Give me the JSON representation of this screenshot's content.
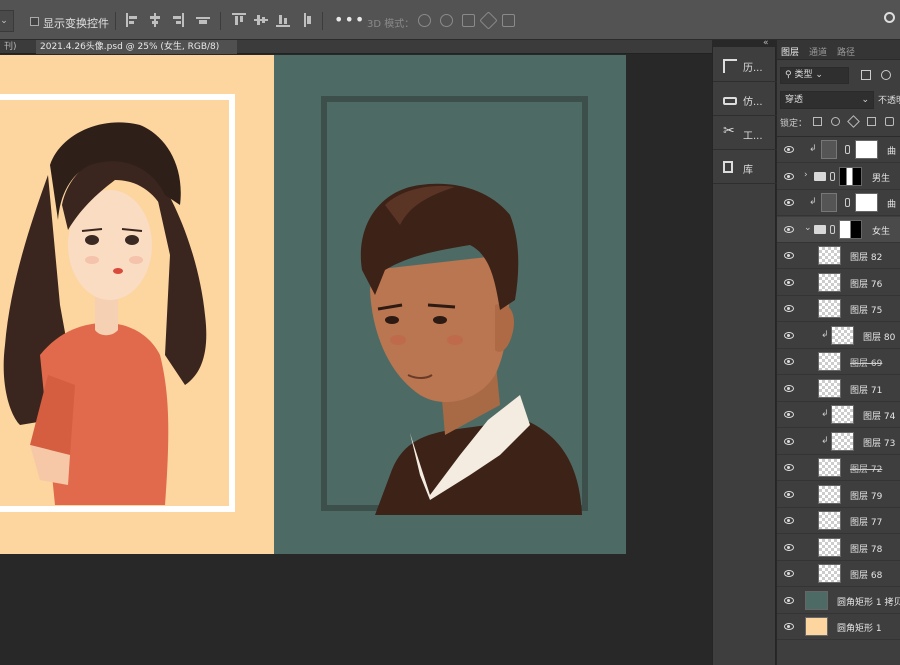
{
  "options_bar": {
    "show_transform_controls": "显示变换控件",
    "mode_3d": "3D 模式："
  },
  "tabs": [
    {
      "label": "刊) *",
      "active": false
    },
    {
      "label": "2021.4.26头像.psd @ 25% (女生, RGB/8) *",
      "active": true
    }
  ],
  "colors": {
    "peach": "#fcd59f",
    "teal": "#4d6b64",
    "frame_dark": "#3c4f4a",
    "ui_bg": "#282828"
  },
  "dock": [
    {
      "label": "历...",
      "icon": "history-icon"
    },
    {
      "label": "仿...",
      "icon": "clone-source-icon"
    },
    {
      "label": "工...",
      "icon": "tool-presets-icon"
    },
    {
      "label": "库",
      "icon": "library-icon"
    }
  ],
  "layers_panel": {
    "tabs": [
      {
        "label": "图层",
        "active": true
      },
      {
        "label": "通道",
        "active": false
      },
      {
        "label": "路径",
        "active": false
      }
    ],
    "filter_kind": "类型",
    "blend_mode": "穿透",
    "opacity_label": "不透明",
    "lock_label": "锁定：",
    "layers": [
      {
        "name": "曲",
        "kind": "adjustment",
        "clip": true,
        "strike": false,
        "selected": false
      },
      {
        "name": "男生",
        "kind": "group",
        "clip": false,
        "strike": false,
        "selected": false,
        "expanded": false
      },
      {
        "name": "曲",
        "kind": "adjustment",
        "clip": true,
        "strike": false,
        "selected": false
      },
      {
        "name": "女生",
        "kind": "group",
        "clip": false,
        "strike": false,
        "selected": true,
        "expanded": true
      },
      {
        "name": "图层 82",
        "kind": "pixel",
        "clip": false,
        "strike": false,
        "selected": false
      },
      {
        "name": "图层 76",
        "kind": "pixel",
        "clip": false,
        "strike": false,
        "selected": false
      },
      {
        "name": "图层 75",
        "kind": "pixel",
        "clip": false,
        "strike": false,
        "selected": false
      },
      {
        "name": "图层 80",
        "kind": "pixel",
        "clip": true,
        "strike": false,
        "selected": false
      },
      {
        "name": "图层 69",
        "kind": "pixel",
        "clip": false,
        "strike": true,
        "selected": false
      },
      {
        "name": "图层 71",
        "kind": "pixel",
        "clip": false,
        "strike": false,
        "selected": false
      },
      {
        "name": "图层 74",
        "kind": "pixel",
        "clip": true,
        "strike": false,
        "selected": false
      },
      {
        "name": "图层 73",
        "kind": "pixel",
        "clip": true,
        "strike": false,
        "selected": false
      },
      {
        "name": "图层 72",
        "kind": "pixel",
        "clip": false,
        "strike": true,
        "selected": false
      },
      {
        "name": "图层 79",
        "kind": "pixel",
        "clip": false,
        "strike": false,
        "selected": false
      },
      {
        "name": "图层 77",
        "kind": "pixel",
        "clip": false,
        "strike": false,
        "selected": false
      },
      {
        "name": "图层 78",
        "kind": "pixel",
        "clip": false,
        "strike": false,
        "selected": false
      },
      {
        "name": "图层 68",
        "kind": "pixel",
        "clip": false,
        "strike": false,
        "selected": false
      },
      {
        "name": "圆角矩形 1 拷贝",
        "kind": "shape-teal",
        "clip": false,
        "strike": false,
        "selected": false
      },
      {
        "name": "圆角矩形 1",
        "kind": "shape-peach",
        "clip": false,
        "strike": false,
        "selected": false
      }
    ]
  }
}
